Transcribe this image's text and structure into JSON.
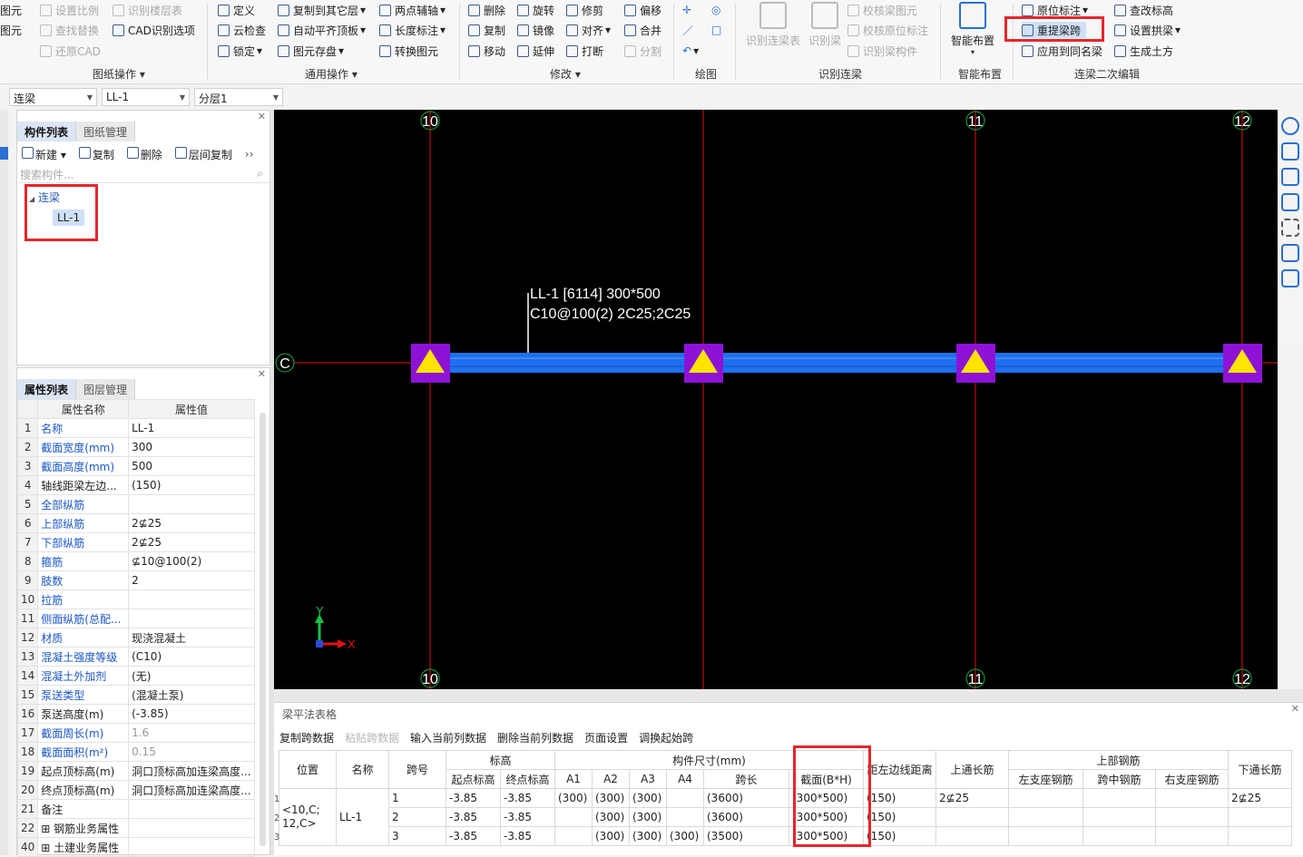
{
  "ribbon": {
    "col0": [
      "图元",
      "图元"
    ],
    "col1": [
      "设置比例",
      "查找替换",
      "还原CAD"
    ],
    "col1b": [
      "识别楼层表",
      "CAD识别选项"
    ],
    "group1": "图纸操作",
    "col2": [
      "定义",
      "云检查",
      "锁定"
    ],
    "col3": [
      "复制到其它层",
      "自动平齐顶板",
      "图元存盘"
    ],
    "col4": [
      "两点辅轴",
      "长度标注",
      "转换图元"
    ],
    "group2": "通用操作",
    "col5": [
      "删除",
      "复制",
      "移动"
    ],
    "col6": [
      "旋转",
      "镜像",
      "延伸"
    ],
    "col7": [
      "修剪",
      "对齐",
      "打断"
    ],
    "col8": [
      "偏移",
      "合并",
      "分割"
    ],
    "group3": "修改",
    "group4": "绘图",
    "recog_big": [
      "识别连梁表",
      "识别梁"
    ],
    "recog_small": [
      "校核梁图元",
      "校核原位标注",
      "识别梁构件"
    ],
    "group5": "识别连梁",
    "smart": "智能布置",
    "group6": "智能布置",
    "edit1": [
      "原位标注",
      "重提梁跨",
      "应用到同名梁"
    ],
    "edit2": [
      "查改标高",
      "设置拱梁",
      "生成土方"
    ],
    "group7": "连梁二次编辑"
  },
  "combos": [
    "连梁",
    "LL-1",
    "分层1"
  ],
  "left": {
    "tabs_top": [
      "构件列表",
      "图纸管理"
    ],
    "toolbar": [
      "新建",
      "复制",
      "删除",
      "层间复制"
    ],
    "search_placeholder": "搜索构件...",
    "tree_parent": "连梁",
    "tree_child": "LL-1",
    "tabs_mid": [
      "属性列表",
      "图层管理"
    ],
    "prop_headers": [
      "属性名称",
      "属性值"
    ],
    "props": [
      {
        "n": "1",
        "name": "名称",
        "val": "LL-1",
        "blue": true
      },
      {
        "n": "2",
        "name": "截面宽度(mm)",
        "val": "300",
        "blue": true
      },
      {
        "n": "3",
        "name": "截面高度(mm)",
        "val": "500",
        "blue": true
      },
      {
        "n": "4",
        "name": "轴线距梁左边...",
        "val": "(150)",
        "blue": false
      },
      {
        "n": "5",
        "name": "全部纵筋",
        "val": "",
        "blue": true
      },
      {
        "n": "6",
        "name": "上部纵筋",
        "val": "2⊈25",
        "blue": true
      },
      {
        "n": "7",
        "name": "下部纵筋",
        "val": "2⊈25",
        "blue": true
      },
      {
        "n": "8",
        "name": "箍筋",
        "val": "⊈10@100(2)",
        "blue": true
      },
      {
        "n": "9",
        "name": "肢数",
        "val": "2",
        "blue": true
      },
      {
        "n": "10",
        "name": "拉筋",
        "val": "",
        "blue": true
      },
      {
        "n": "11",
        "name": "侧面纵筋(总配...",
        "val": "",
        "blue": true
      },
      {
        "n": "12",
        "name": "材质",
        "val": "现浇混凝土",
        "blue": true
      },
      {
        "n": "13",
        "name": "混凝土强度等级",
        "val": "(C10)",
        "blue": true
      },
      {
        "n": "14",
        "name": "混凝土外加剂",
        "val": "(无)",
        "blue": true
      },
      {
        "n": "15",
        "name": "泵送类型",
        "val": "(混凝土泵)",
        "blue": true
      },
      {
        "n": "16",
        "name": "泵送高度(m)",
        "val": "(-3.85)",
        "blue": false
      },
      {
        "n": "17",
        "name": "截面周长(m)",
        "val": "1.6",
        "blue": true,
        "gray": true
      },
      {
        "n": "18",
        "name": "截面面积(m²)",
        "val": "0.15",
        "blue": true,
        "gray": true
      },
      {
        "n": "19",
        "name": "起点顶标高(m)",
        "val": "洞口顶标高加连梁高度...",
        "blue": false
      },
      {
        "n": "20",
        "name": "终点顶标高(m)",
        "val": "洞口顶标高加连梁高度...",
        "blue": false
      },
      {
        "n": "21",
        "name": "备注",
        "val": "",
        "blue": false
      },
      {
        "n": "22",
        "name": "⊞ 钢筋业务属性",
        "val": "",
        "blue": false
      },
      {
        "n": "40",
        "name": "⊞ 土建业务属性",
        "val": "",
        "blue": false
      }
    ]
  },
  "canvas": {
    "axes_top": [
      "10",
      "11",
      "12"
    ],
    "axes_bottom": [
      "10",
      "11",
      "12"
    ],
    "row_label": "C",
    "beam_text1": "LL-1 [6114] 300*500",
    "beam_text2": "C10@100(2) 2C25;2C25",
    "ucs_x": "X",
    "ucs_y": "Y"
  },
  "bottom": {
    "title": "梁平法表格",
    "toolbar": [
      "复制跨数据",
      "粘贴跨数据",
      "输入当前列数据",
      "删除当前列数据",
      "页面设置",
      "调换起始跨"
    ],
    "toolbar_disabled": [
      false,
      true,
      false,
      false,
      false,
      false
    ],
    "h1": [
      "位置",
      "名称",
      "跨号",
      "标高",
      "构件尺寸(mm)",
      "上通长筋",
      "上部钢筋",
      "下通长筋"
    ],
    "h2": [
      "起点标高",
      "终点标高",
      "A1",
      "A2",
      "A3",
      "A4",
      "跨长",
      "截面(B*H)",
      "距左边线距离",
      "左支座钢筋",
      "跨中钢筋",
      "右支座钢筋"
    ],
    "pos": "<10,C;\n12,C>",
    "name": "LL-1",
    "top_through": "2⊈25",
    "bot_through": "2⊈25",
    "rows": [
      {
        "i": "1",
        "span": "1",
        "s": "-3.85",
        "e": "-3.85",
        "a1": "(300)",
        "a2": "(300)",
        "a3": "(300)",
        "a4": "",
        "len": "(3600)",
        "sec": "(300*500)",
        "dist": "(150)"
      },
      {
        "i": "2",
        "span": "2",
        "s": "-3.85",
        "e": "-3.85",
        "a1": "",
        "a2": "(300)",
        "a3": "(300)",
        "a4": "",
        "len": "(3600)",
        "sec": "(300*500)",
        "dist": "(150)"
      },
      {
        "i": "3",
        "span": "3",
        "s": "-3.85",
        "e": "-3.85",
        "a1": "",
        "a2": "(300)",
        "a3": "(300)",
        "a4": "(300)",
        "len": "(3500)",
        "sec": "(300*500)",
        "dist": "(150)"
      }
    ]
  },
  "colors": {
    "beam": "#1e6ff0",
    "column": "#8e12d6",
    "triangle": "#ffe400",
    "axis": "#e01010",
    "highlight": "#e5262c"
  }
}
